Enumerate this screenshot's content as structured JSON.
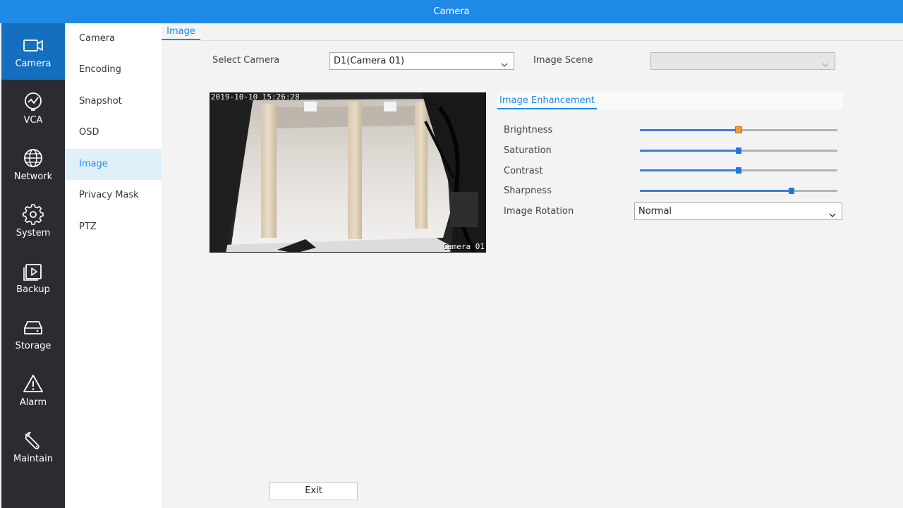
{
  "window": {
    "title": "Camera"
  },
  "main_nav": {
    "items": [
      {
        "label": "Camera",
        "icon": "camera-icon",
        "active": true
      },
      {
        "label": "VCA",
        "icon": "vca-icon",
        "active": false
      },
      {
        "label": "Network",
        "icon": "globe-icon",
        "active": false
      },
      {
        "label": "System",
        "icon": "gear-icon",
        "active": false
      },
      {
        "label": "Backup",
        "icon": "backup-icon",
        "active": false
      },
      {
        "label": "Storage",
        "icon": "storage-icon",
        "active": false
      },
      {
        "label": "Alarm",
        "icon": "alarm-icon",
        "active": false
      },
      {
        "label": "Maintain",
        "icon": "wrench-icon",
        "active": false
      }
    ]
  },
  "sub_nav": {
    "items": [
      {
        "label": "Camera"
      },
      {
        "label": "Encoding"
      },
      {
        "label": "Snapshot"
      },
      {
        "label": "OSD"
      },
      {
        "label": "Image",
        "active": true
      },
      {
        "label": "Privacy Mask"
      },
      {
        "label": "PTZ"
      }
    ]
  },
  "page": {
    "tab": "Image",
    "select_camera_label": "Select Camera",
    "select_camera_value": "D1(Camera 01)",
    "image_scene_label": "Image Scene",
    "image_scene_value": "",
    "preview": {
      "timestamp": "2019-10-10  15:26:28",
      "camera_name": "Camera 01"
    },
    "enhancement": {
      "tab": "Image Enhancement",
      "sliders": [
        {
          "label": "Brightness",
          "value_fraction": 0.5,
          "thumb_color": "#f29a3a"
        },
        {
          "label": "Saturation",
          "value_fraction": 0.5,
          "thumb_color": "#1e7ad8"
        },
        {
          "label": "Contrast",
          "value_fraction": 0.5,
          "thumb_color": "#1e7ad8"
        },
        {
          "label": "Sharpness",
          "value_fraction": 0.767,
          "thumb_color": "#1e7ad8"
        }
      ],
      "rotation_label": "Image Rotation",
      "rotation_value": "Normal"
    },
    "exit_label": "Exit"
  },
  "colors": {
    "accent": "#1e8ae6",
    "nav_bg": "#2a2c31",
    "nav_active": "#146fbf"
  }
}
